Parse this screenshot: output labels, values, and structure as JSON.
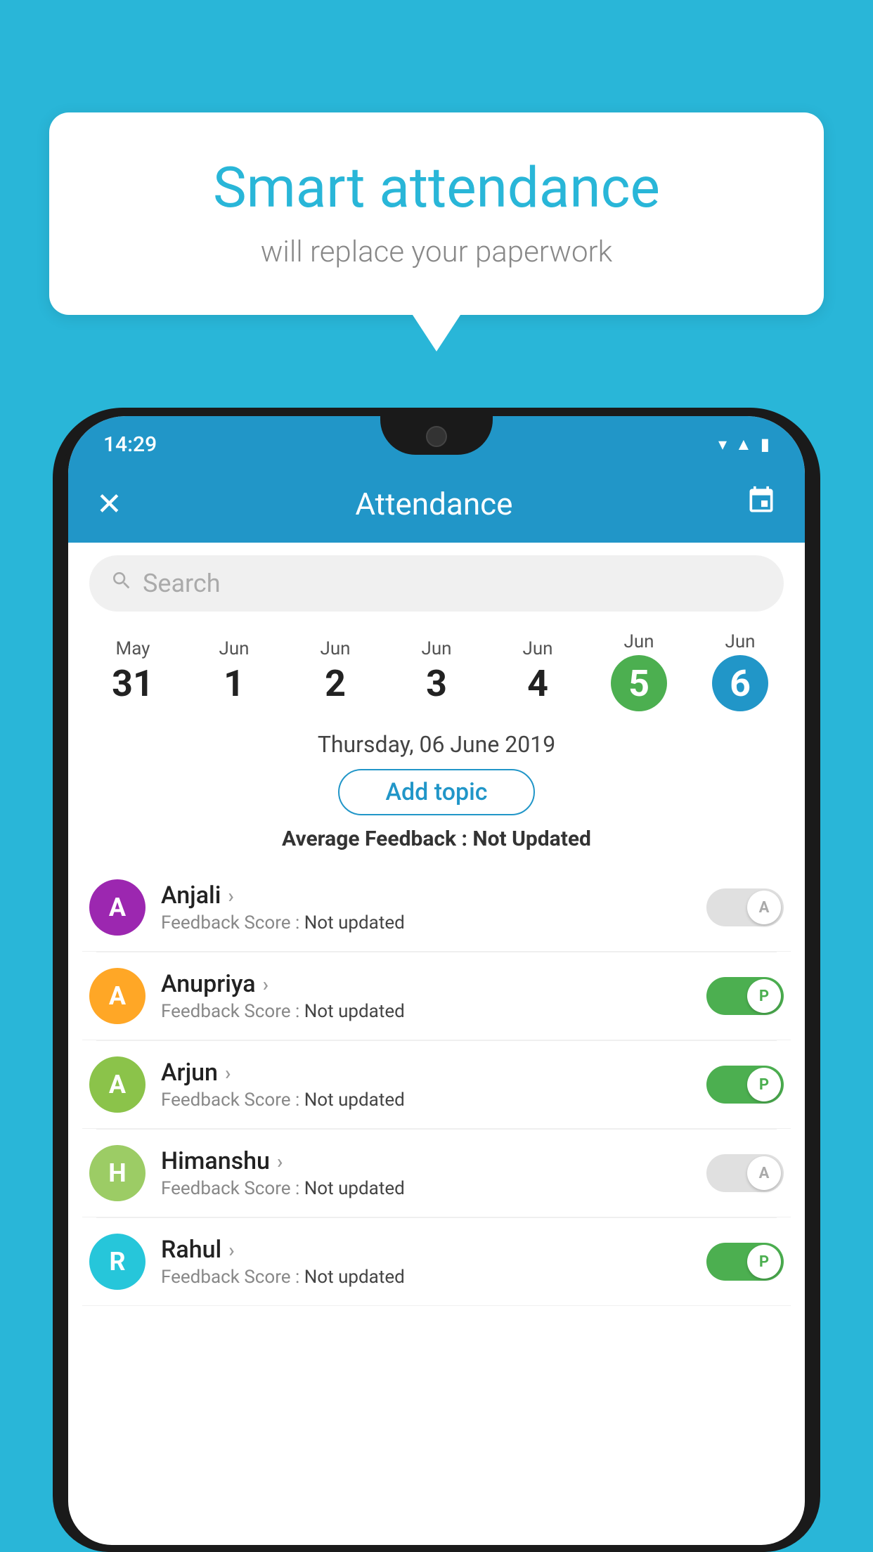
{
  "background_color": "#29B6D8",
  "speech_bubble": {
    "title": "Smart attendance",
    "subtitle": "will replace your paperwork"
  },
  "app": {
    "status_bar": {
      "time": "14:29"
    },
    "header": {
      "title": "Attendance",
      "close_icon": "✕",
      "calendar_icon": "📅"
    },
    "search": {
      "placeholder": "Search"
    },
    "dates": [
      {
        "month": "May",
        "day": "31",
        "selected": false
      },
      {
        "month": "Jun",
        "day": "1",
        "selected": false
      },
      {
        "month": "Jun",
        "day": "2",
        "selected": false
      },
      {
        "month": "Jun",
        "day": "3",
        "selected": false
      },
      {
        "month": "Jun",
        "day": "4",
        "selected": false
      },
      {
        "month": "Jun",
        "day": "5",
        "selected": "green"
      },
      {
        "month": "Jun",
        "day": "6",
        "selected": "blue"
      }
    ],
    "selected_date": "Thursday, 06 June 2019",
    "add_topic_label": "Add topic",
    "avg_feedback_label": "Average Feedback : ",
    "avg_feedback_value": "Not Updated",
    "students": [
      {
        "name": "Anjali",
        "avatar_letter": "A",
        "avatar_color": "purple",
        "feedback_label": "Feedback Score : ",
        "feedback_value": "Not updated",
        "toggle": "off",
        "toggle_letter": "A"
      },
      {
        "name": "Anupriya",
        "avatar_letter": "A",
        "avatar_color": "yellow",
        "feedback_label": "Feedback Score : ",
        "feedback_value": "Not updated",
        "toggle": "on",
        "toggle_letter": "P"
      },
      {
        "name": "Arjun",
        "avatar_letter": "A",
        "avatar_color": "green",
        "feedback_label": "Feedback Score : ",
        "feedback_value": "Not updated",
        "toggle": "on",
        "toggle_letter": "P"
      },
      {
        "name": "Himanshu",
        "avatar_letter": "H",
        "avatar_color": "olive",
        "feedback_label": "Feedback Score : ",
        "feedback_value": "Not updated",
        "toggle": "off",
        "toggle_letter": "A"
      },
      {
        "name": "Rahul",
        "avatar_letter": "R",
        "avatar_color": "teal",
        "feedback_label": "Feedback Score : ",
        "feedback_value": "Not updated",
        "toggle": "on",
        "toggle_letter": "P"
      }
    ]
  }
}
